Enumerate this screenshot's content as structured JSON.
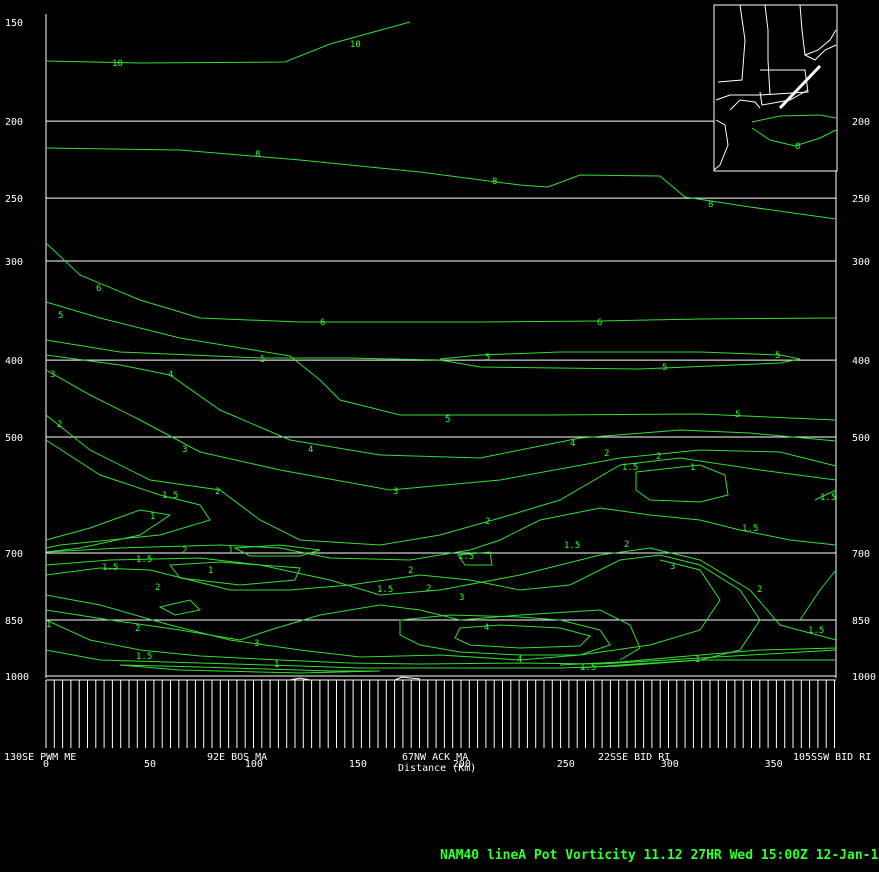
{
  "chart_data": {
    "type": "contour",
    "footer": "NAM40 lineA  Pot Vorticity  11.12  27HR Wed 15:00Z 12-Jan-11",
    "xlabel": "Distance (Km)",
    "x_ticks": [
      "0",
      "50",
      "100",
      "150",
      "200",
      "250",
      "300",
      "350"
    ],
    "pressure_levels": [
      "150",
      "200",
      "250",
      "300",
      "400",
      "500",
      "700",
      "850",
      "1000"
    ],
    "locations": [
      "130SE PWM ME",
      "92E BOS MA",
      "67NW ACK MA",
      "22SSE BID RI",
      "105SSW BID RI"
    ],
    "contour_labels": [
      {
        "label": "10"
      },
      {
        "label": "10"
      },
      {
        "label": "8"
      },
      {
        "label": "8"
      },
      {
        "label": "8"
      },
      {
        "label": "6"
      },
      {
        "label": "6"
      },
      {
        "label": "6"
      },
      {
        "label": "5"
      },
      {
        "label": "5"
      },
      {
        "label": "5"
      },
      {
        "label": "5"
      },
      {
        "label": "5"
      },
      {
        "label": "5"
      },
      {
        "label": "5"
      },
      {
        "label": "4"
      },
      {
        "label": "4"
      },
      {
        "label": "4"
      },
      {
        "label": "4"
      },
      {
        "label": "3"
      },
      {
        "label": "3"
      },
      {
        "label": "3"
      },
      {
        "label": "3"
      },
      {
        "label": "3"
      },
      {
        "label": "3"
      },
      {
        "label": "2"
      },
      {
        "label": "2"
      },
      {
        "label": "2"
      },
      {
        "label": "2"
      },
      {
        "label": "2"
      },
      {
        "label": "2"
      },
      {
        "label": "2"
      },
      {
        "label": "2"
      },
      {
        "label": "2"
      },
      {
        "label": "2"
      },
      {
        "label": "2"
      },
      {
        "label": "2"
      },
      {
        "label": "1.5"
      },
      {
        "label": "1.5"
      },
      {
        "label": "1.5"
      },
      {
        "label": "1.5"
      },
      {
        "label": "1.5"
      },
      {
        "label": "1.5"
      },
      {
        "label": "1.5"
      },
      {
        "label": "1.5"
      },
      {
        "label": "1.5"
      },
      {
        "label": "1.5"
      },
      {
        "label": "1.5"
      },
      {
        "label": "1.5"
      },
      {
        "label": "1"
      },
      {
        "label": "1"
      },
      {
        "label": "1"
      },
      {
        "label": "1"
      },
      {
        "label": "1"
      },
      {
        "label": "1"
      },
      {
        "label": "1"
      },
      {
        "label": "4"
      }
    ],
    "inset_map": {
      "contour_label": "8"
    },
    "colors": {
      "background": "#000000",
      "contours": "#33dd33",
      "grid": "#ffffff",
      "footer": "#33ff33"
    }
  }
}
